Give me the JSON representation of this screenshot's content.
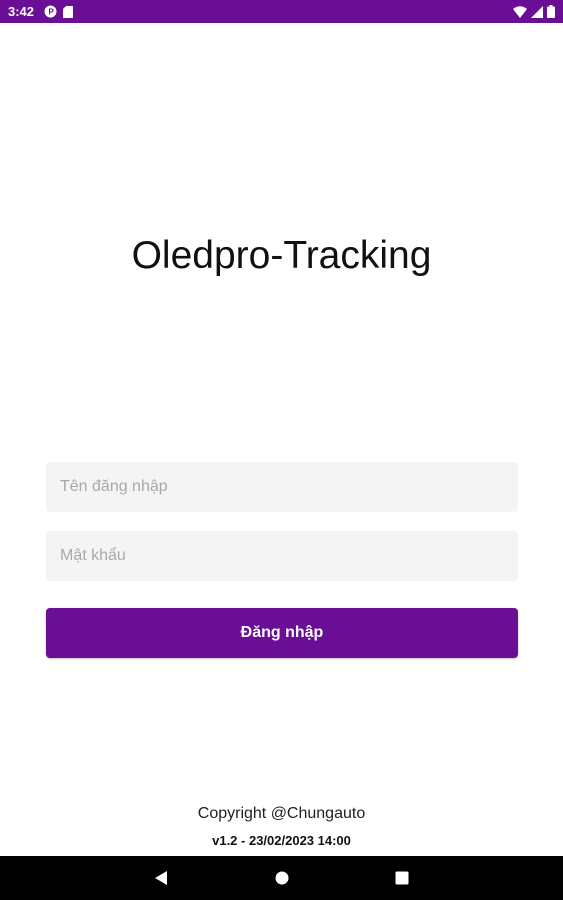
{
  "status_bar": {
    "time": "3:42",
    "background_color": "#6a0e96",
    "left_icons": [
      "notification-badge-icon",
      "sd-card-icon"
    ],
    "right_icons": [
      "wifi-icon",
      "signal-icon",
      "battery-icon"
    ]
  },
  "app": {
    "title": "Oledpro-Tracking",
    "accent_color": "#6a0e96"
  },
  "login_form": {
    "username_placeholder": "Tên đăng nhập",
    "username_value": "",
    "password_placeholder": "Mật khẩu",
    "password_value": "",
    "submit_label": "Đăng nhập"
  },
  "footer": {
    "copyright": "Copyright @Chungauto",
    "version": "v1.2 - 23/02/2023 14:00"
  },
  "nav_bar": {
    "buttons": [
      "back-icon",
      "home-icon",
      "recents-icon"
    ]
  }
}
